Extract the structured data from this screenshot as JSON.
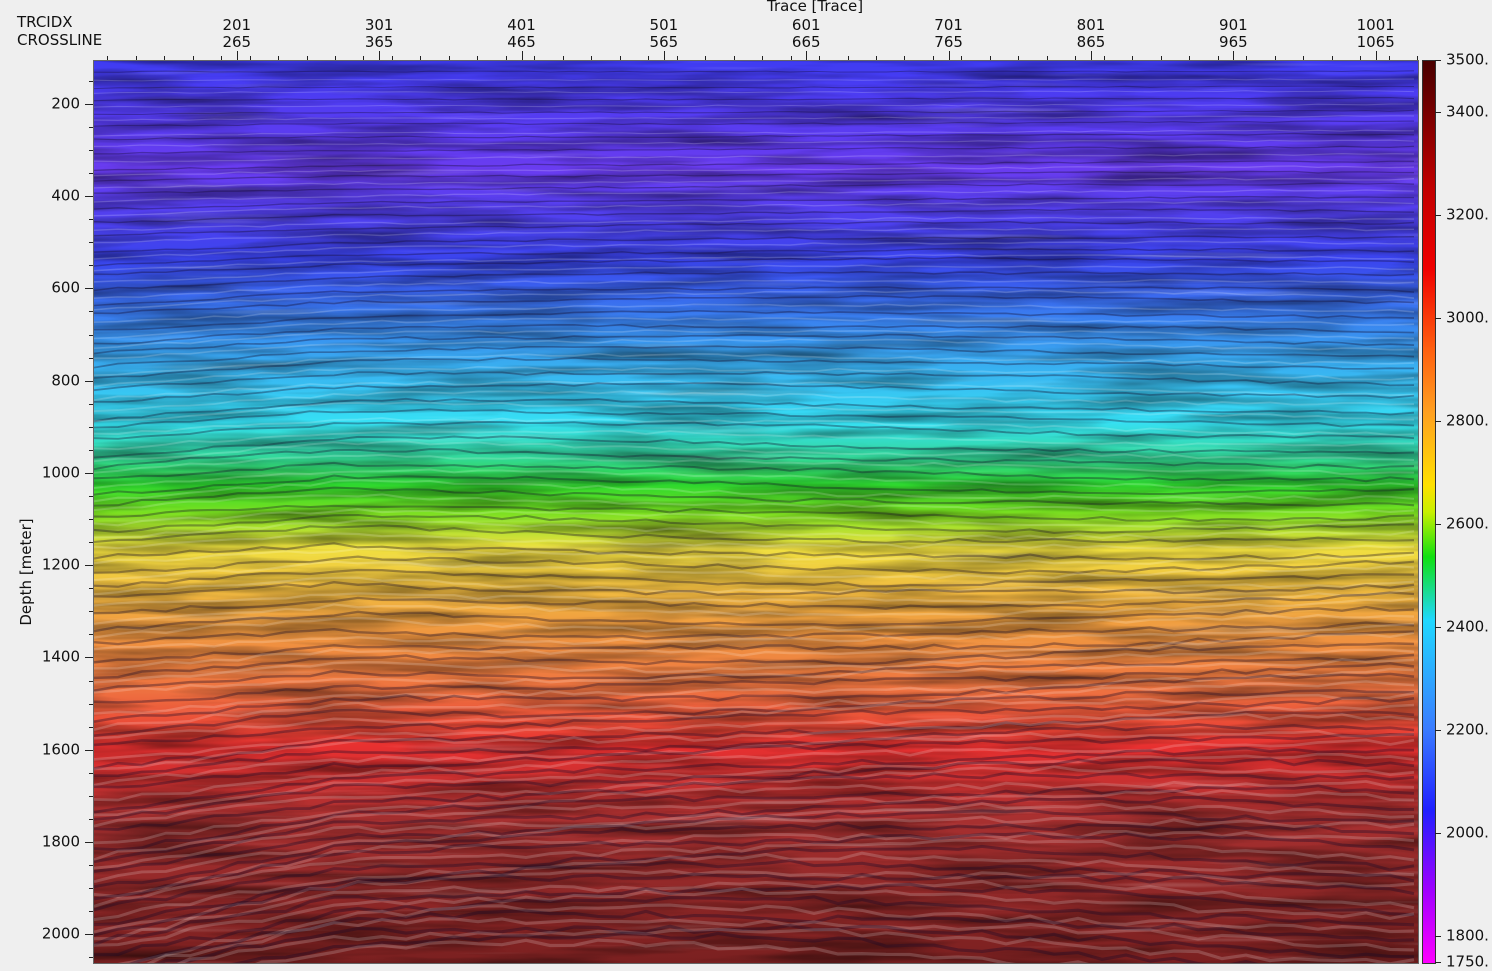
{
  "window": {
    "x_axis_title": "Trace [Trace]",
    "y_axis_title": "Depth [meter]",
    "header_rows": [
      "TRCIDX",
      "CROSSLINE"
    ]
  },
  "axes": {
    "trcidx_ticks": [
      "201",
      "301",
      "401",
      "501",
      "601",
      "701",
      "801",
      "901",
      "1001"
    ],
    "crossline_ticks": [
      "265",
      "365",
      "465",
      "565",
      "665",
      "765",
      "865",
      "965",
      "1065"
    ],
    "depth_ticks": [
      "200",
      "400",
      "600",
      "800",
      "1000",
      "1200",
      "1400",
      "1600",
      "1800",
      "2000"
    ],
    "depth_range": [
      105,
      2060
    ],
    "trcidx_range": [
      100,
      1030
    ]
  },
  "colorbar": {
    "labels": [
      "3500.",
      "3400.",
      "3200.",
      "3000.",
      "2800.",
      "2600.",
      "2400.",
      "2200.",
      "2000.",
      "1800.",
      "1750."
    ],
    "values": [
      3500,
      3400,
      3200,
      3000,
      2800,
      2600,
      2400,
      2200,
      2000,
      1800,
      1750
    ],
    "range": [
      1750,
      3500
    ],
    "colors": [
      "#ff00ff",
      "#a000ff",
      "#2020ff",
      "#3a7cff",
      "#20d8ff",
      "#10e010",
      "#ffe000",
      "#ffa020",
      "#f00000",
      "#c00000",
      "#4a0000"
    ]
  },
  "icons": {
    "colorbar": "colorbar-scale",
    "seismic": "seismic-section-image"
  }
}
